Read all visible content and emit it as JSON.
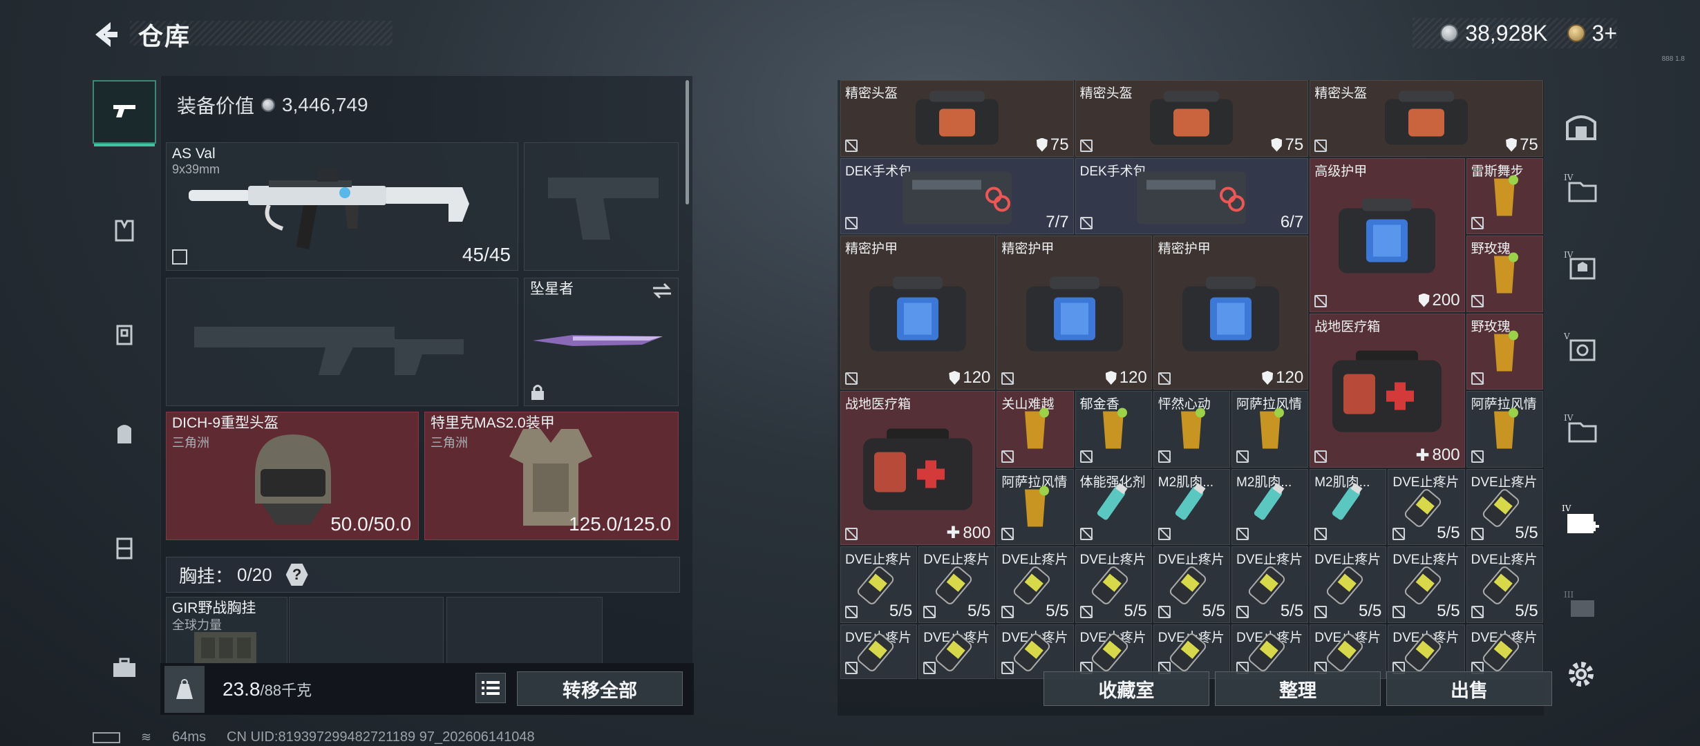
{
  "header": {
    "title": "仓库",
    "currency_value": "38,928K",
    "gold_value": "3+",
    "tiny_text": "888 1.8"
  },
  "left": {
    "equip_value_label": "装备价值",
    "equip_value": "3,446,749",
    "primary": {
      "name": "AS Val",
      "ammo": "9x39mm",
      "count": "45/45"
    },
    "melee": {
      "name": "坠星者"
    },
    "helmet": {
      "name": "DICH-9重型头盔",
      "sub": "三角洲",
      "durability": "50.0/50.0"
    },
    "armor": {
      "name": "特里克MAS2.0装甲",
      "sub": "三角洲",
      "durability": "125.0/125.0"
    },
    "chest_label": "胸挂：",
    "chest_count": "0/20",
    "chest_help": "?",
    "chest_item": {
      "name": "GIR野战胸挂",
      "sub": "全球力量"
    },
    "weight": "23.8",
    "weight_max": "/88千克",
    "transfer_all": "转移全部"
  },
  "grid_items": [
    {
      "name": "精密头盔",
      "value": "75",
      "type": "shield"
    },
    {
      "name": "精密头盔",
      "value": "75",
      "type": "shield"
    },
    {
      "name": "精密头盔",
      "value": "75",
      "type": "shield"
    },
    {
      "name": "DEK手术包",
      "value": "7/7",
      "type": "plain"
    },
    {
      "name": "DEK手术包",
      "value": "6/7",
      "type": "plain"
    },
    {
      "name": "高级护甲",
      "value": "200",
      "type": "shield"
    },
    {
      "name": "雷斯舞步",
      "value": "",
      "type": "plain"
    },
    {
      "name": "精密护甲",
      "value": "120",
      "type": "shield"
    },
    {
      "name": "精密护甲",
      "value": "120",
      "type": "shield"
    },
    {
      "name": "精密护甲",
      "value": "120",
      "type": "shield"
    },
    {
      "name": "野玫瑰",
      "value": "",
      "type": "plain"
    },
    {
      "name": "战地医疗箱",
      "value": "800",
      "type": "plus"
    },
    {
      "name": "野玫瑰",
      "value": "",
      "type": "plain"
    },
    {
      "name": "战地医疗箱",
      "value": "800",
      "type": "plus"
    },
    {
      "name": "关山难越",
      "value": "",
      "type": "plain"
    },
    {
      "name": "郁金香",
      "value": "",
      "type": "plain"
    },
    {
      "name": "怦然心动",
      "value": "",
      "type": "plain"
    },
    {
      "name": "阿萨拉风情",
      "value": "",
      "type": "plain"
    },
    {
      "name": "阿萨拉风情",
      "value": "",
      "type": "plain"
    },
    {
      "name": "阿萨拉风情",
      "value": "",
      "type": "plain"
    },
    {
      "name": "体能强化剂",
      "value": "",
      "type": "plain"
    },
    {
      "name": "M2肌肉...",
      "value": "",
      "type": "plain"
    },
    {
      "name": "M2肌肉...",
      "value": "",
      "type": "plain"
    },
    {
      "name": "M2肌肉...",
      "value": "",
      "type": "plain"
    },
    {
      "name": "DVE止疼片",
      "value": "5/5",
      "type": "plain"
    },
    {
      "name": "DVE止疼片",
      "value": "5/5",
      "type": "plain"
    }
  ],
  "pill_row": {
    "name": "DVE止疼片",
    "value": "5/5"
  },
  "buttons": {
    "collection": "收藏室",
    "organize": "整理",
    "sell": "出售"
  },
  "status": {
    "ping": "64ms",
    "uid": "CN UID:819397299482721189 97_202606141048"
  },
  "colors": {
    "accent": "#3fc4a3",
    "red_cell": "#553036",
    "blue_cell": "#33384a",
    "brown_cell": "#3d3330"
  }
}
